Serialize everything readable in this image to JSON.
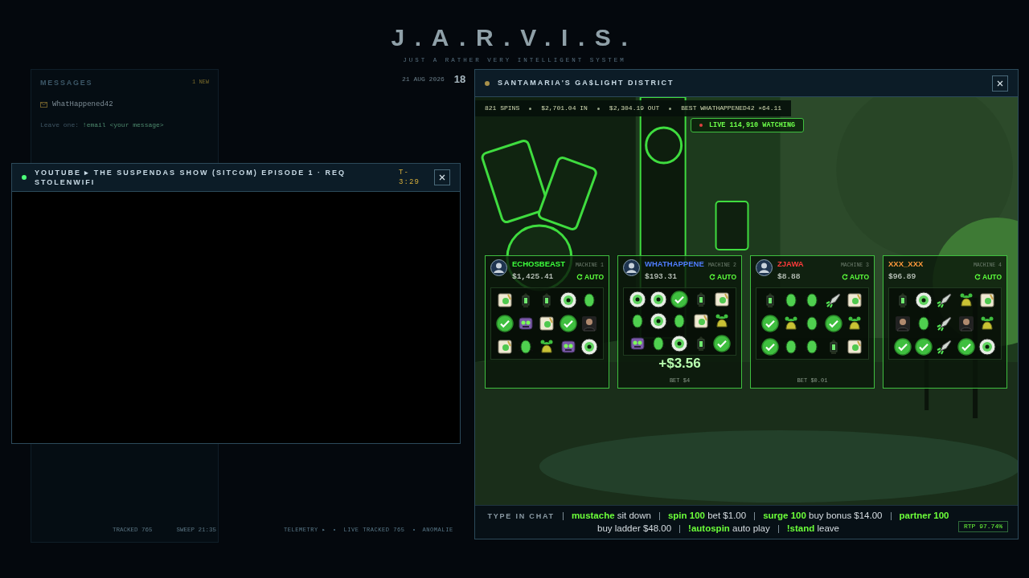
{
  "background": {
    "title": "J.A.R.V.I.S.",
    "subtitle": "JUST A RATHER VERY INTELLIGENT SYSTEM",
    "date": "21 AUG 2026",
    "time": "18",
    "messages": {
      "title": "MESSAGES",
      "badge": "1 NEW",
      "sender": "WhatHappened42",
      "hint_label": "Leave one:",
      "hint_command": "!email <your message>"
    },
    "panel_footer": [
      "TRACKED 765",
      "SWEEP 21:35"
    ],
    "telemetry": [
      "TELEMETRY ▸",
      "LIVE TRACKED 765",
      "ANOMALIE"
    ]
  },
  "video_window": {
    "title": "YOUTUBE ▸ THE SUSPENDAS SHOW (SITCOM) EPISODE 1 · REQ STOLENWIFI",
    "timer": "T-3:29",
    "live": true
  },
  "casino_window": {
    "title": "SANTAMARIA'S GA$LIGHT DISTRICT",
    "stats": [
      "821 SPINS",
      "$2,701.04 IN",
      "$2,304.19 OUT",
      "BEST WHATHAPPENED42 ×64.11"
    ],
    "live": {
      "label": "LIVE",
      "count": "114,910",
      "suffix": "WATCHING"
    },
    "machines": [
      {
        "label": "MACHINE 1",
        "player": "ECHOSBEAST",
        "color": "#3dff3d",
        "avatar": true,
        "balance": "$1,425.41",
        "auto": true,
        "auto_label": "AUTO",
        "reels": [
          [
            {
              "kind": "scroll"
            },
            {
              "kind": "lantern"
            },
            {
              "kind": "lantern"
            },
            {
              "kind": "eye"
            },
            {
              "kind": "beetle"
            }
          ],
          [
            {
              "kind": "check"
            },
            {
              "kind": "robot"
            },
            {
              "kind": "scroll"
            },
            {
              "kind": "check"
            },
            {
              "kind": "person"
            }
          ],
          [
            {
              "kind": "scroll"
            },
            {
              "kind": "beetle"
            },
            {
              "kind": "bag"
            },
            {
              "kind": "robot"
            },
            {
              "kind": "eye"
            }
          ]
        ]
      },
      {
        "label": "MACHINE 2",
        "player": "WHATHAPPENE",
        "color": "#4f7dff",
        "avatar": true,
        "balance": "$193.31",
        "auto": true,
        "auto_label": "AUTO",
        "reels": [
          [
            {
              "kind": "eye"
            },
            {
              "kind": "eye"
            },
            {
              "kind": "check"
            },
            {
              "kind": "lantern"
            },
            {
              "kind": "scroll"
            }
          ],
          [
            {
              "kind": "beetle"
            },
            {
              "kind": "eye"
            },
            {
              "kind": "beetle"
            },
            {
              "kind": "scroll"
            },
            {
              "kind": "bag"
            }
          ],
          [
            {
              "kind": "robot"
            },
            {
              "kind": "beetle"
            },
            {
              "kind": "eye"
            },
            {
              "kind": "lantern"
            },
            {
              "kind": "check"
            }
          ]
        ],
        "win": "+$3.56",
        "bet": "BET $4"
      },
      {
        "label": "MACHINE 3",
        "player": "ZJAWA",
        "color": "#ff3b3b",
        "avatar": true,
        "balance": "$8.88",
        "auto": true,
        "auto_label": "AUTO",
        "reels": [
          [
            {
              "kind": "lantern"
            },
            {
              "kind": "beetle"
            },
            {
              "kind": "beetle"
            },
            {
              "kind": "rocket"
            },
            {
              "kind": "scroll"
            }
          ],
          [
            {
              "kind": "check"
            },
            {
              "kind": "bag"
            },
            {
              "kind": "beetle"
            },
            {
              "kind": "check"
            },
            {
              "kind": "bag"
            }
          ],
          [
            {
              "kind": "check"
            },
            {
              "kind": "beetle"
            },
            {
              "kind": "beetle"
            },
            {
              "kind": "lantern"
            },
            {
              "kind": "scroll"
            }
          ]
        ],
        "bet": "BET $0.01"
      },
      {
        "label": "MACHINE 4",
        "player": "XXX_XXX",
        "color": "#ff9a3c",
        "avatar": false,
        "balance": "$96.89",
        "auto": true,
        "auto_label": "AUTO",
        "reels": [
          [
            {
              "kind": "lantern"
            },
            {
              "kind": "eye"
            },
            {
              "kind": "rocket"
            },
            {
              "kind": "bag"
            },
            {
              "kind": "scroll"
            }
          ],
          [
            {
              "kind": "person"
            },
            {
              "kind": "beetle"
            },
            {
              "kind": "rocket"
            },
            {
              "kind": "person"
            },
            {
              "kind": "bag"
            }
          ],
          [
            {
              "kind": "check"
            },
            {
              "kind": "check"
            },
            {
              "kind": "rocket"
            },
            {
              "kind": "check"
            },
            {
              "kind": "eye"
            }
          ]
        ]
      }
    ],
    "chat_label": "TYPE IN CHAT",
    "commands": [
      {
        "cmd": "mustache",
        "desc": "sit down"
      },
      {
        "cmd": "spin 100",
        "desc": "bet $1.00"
      },
      {
        "cmd": "surge 100",
        "desc": "buy bonus $14.00"
      },
      {
        "cmd": "partner 100",
        "desc": "buy ladder $48.00"
      },
      {
        "cmd": "!autospin",
        "desc": "auto play"
      },
      {
        "cmd": "!stand",
        "desc": "leave"
      }
    ],
    "rtp": "RTP 97.74%"
  }
}
